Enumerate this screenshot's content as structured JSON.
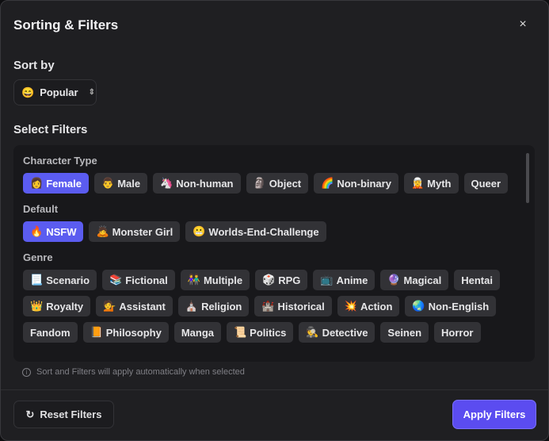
{
  "title": "Sorting & Filters",
  "close_icon": "×",
  "sort": {
    "label": "Sort by",
    "icon": "😄",
    "value": "Popular",
    "chevron": "⌃⌄"
  },
  "filters_label": "Select Filters",
  "groups": [
    {
      "title": "Character Type",
      "chips": [
        {
          "emoji": "👩",
          "label": "Female",
          "active": true
        },
        {
          "emoji": "👨",
          "label": "Male"
        },
        {
          "emoji": "🦄",
          "label": "Non-human"
        },
        {
          "emoji": "🗿",
          "label": "Object"
        },
        {
          "emoji": "🌈",
          "label": "Non-binary"
        },
        {
          "emoji": "🧝",
          "label": "Myth"
        },
        {
          "emoji": "",
          "label": "Queer"
        }
      ]
    },
    {
      "title": "Default",
      "chips": [
        {
          "emoji": "🔥",
          "label": "NSFW",
          "active": true
        },
        {
          "emoji": "🙇",
          "label": "Monster Girl"
        },
        {
          "emoji": "😬",
          "label": "Worlds-End-Challenge"
        }
      ]
    },
    {
      "title": "Genre",
      "chips": [
        {
          "emoji": "📃",
          "label": "Scenario"
        },
        {
          "emoji": "📚",
          "label": "Fictional"
        },
        {
          "emoji": "👫",
          "label": "Multiple"
        },
        {
          "emoji": "🎲",
          "label": "RPG"
        },
        {
          "emoji": "📺",
          "label": "Anime"
        },
        {
          "emoji": "🔮",
          "label": "Magical"
        },
        {
          "emoji": "",
          "label": "Hentai"
        },
        {
          "emoji": "👑",
          "label": "Royalty"
        },
        {
          "emoji": "💁",
          "label": "Assistant"
        },
        {
          "emoji": "⛪",
          "label": "Religion"
        },
        {
          "emoji": "🏰",
          "label": "Historical"
        },
        {
          "emoji": "💥",
          "label": "Action"
        },
        {
          "emoji": "🌏",
          "label": "Non-English"
        },
        {
          "emoji": "",
          "label": "Fandom"
        },
        {
          "emoji": "📙",
          "label": "Philosophy"
        },
        {
          "emoji": "",
          "label": "Manga"
        },
        {
          "emoji": "📜",
          "label": "Politics"
        },
        {
          "emoji": "🕵",
          "label": "Detective"
        },
        {
          "emoji": "",
          "label": "Seinen"
        },
        {
          "emoji": "",
          "label": "Horror"
        }
      ]
    }
  ],
  "info": "Sort and Filters will apply automatically when selected",
  "reset_label": "Reset Filters",
  "reset_icon": "↻",
  "apply_label": "Apply Filters"
}
